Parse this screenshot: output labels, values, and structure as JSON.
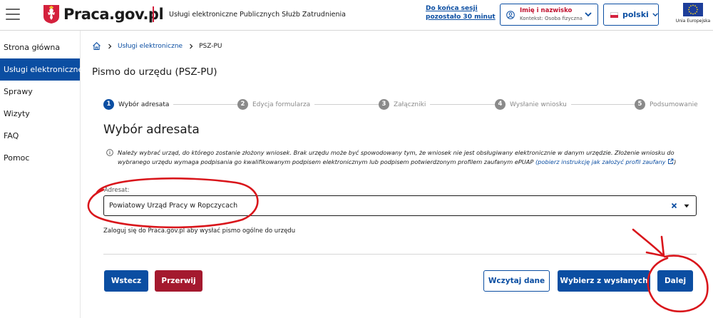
{
  "header": {
    "logo_text": "Praca.gov.pl",
    "service_name": "Usługi elektroniczne Publicznych Służb Zatrudnienia",
    "session_line1": "Do końca sesji",
    "session_line2": "pozostało 30 minut",
    "user_name": "Imię i nazwisko",
    "user_context": "Kontekst: Osoba fizyczna",
    "language": "polski",
    "eu_label": "Unia Europejska"
  },
  "sidebar": {
    "items": [
      {
        "label": "Strona główna",
        "active": false
      },
      {
        "label": "Usługi elektroniczne",
        "active": true
      },
      {
        "label": "Sprawy",
        "active": false
      },
      {
        "label": "Wizyty",
        "active": false
      },
      {
        "label": "FAQ",
        "active": false
      },
      {
        "label": "Pomoc",
        "active": false
      }
    ]
  },
  "breadcrumb": {
    "items": [
      "Usługi elektroniczne",
      "PSZ-PU"
    ]
  },
  "page_title": "Pismo do urzędu (PSZ-PU)",
  "stepper": {
    "steps": [
      {
        "num": "1",
        "label": "Wybór adresata",
        "active": true
      },
      {
        "num": "2",
        "label": "Edycja formularza",
        "active": false
      },
      {
        "num": "3",
        "label": "Załączniki",
        "active": false
      },
      {
        "num": "4",
        "label": "Wysłanie wniosku",
        "active": false
      },
      {
        "num": "5",
        "label": "Podsumowanie",
        "active": false
      }
    ]
  },
  "section_title": "Wybór adresata",
  "info": {
    "text": "Należy wybrać urząd, do którego zostanie złożony wniosek. Brak urzędu może być spowodowany tym, że wniosek nie jest obsługiwany elektronicznie w danym urzędzie. Złożenie wniosku do wybranego urzędu wymaga podpisania go kwalifikowanym podpisem elektronicznym lub podpisem potwierdzonym profilem zaufanym ePUAP",
    "link_text": "(pobierz instrukcję jak założyć profil zaufany",
    "link_suffix": ")"
  },
  "addressee": {
    "label": "Adresat:",
    "value": "Powiatowy Urząd Pracy w Ropczycach"
  },
  "login_hint": "Zaloguj się do Praca.gov.pl aby wysłać pismo ogólne do urzędu",
  "buttons": {
    "back": "Wstecz",
    "abort": "Przerwij",
    "load": "Wczytaj dane",
    "choose_sent": "Wybierz z wysłanych",
    "next": "Dalej"
  },
  "colors": {
    "primary": "#0b4ea2",
    "danger": "#a4192e",
    "annotation": "#d9151b"
  }
}
